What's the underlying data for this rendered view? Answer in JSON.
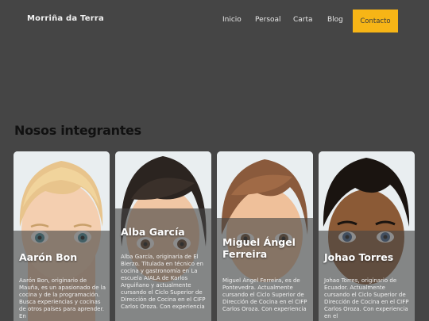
{
  "navbar": {
    "brand": "Morriña da Terra",
    "links": [
      "Inicio",
      "Persoal",
      "Carta",
      "Blog"
    ],
    "cta": "Contacto"
  },
  "colors": {
    "background": "#454545",
    "accent": "#f7b516"
  },
  "section": {
    "title": "Nosos integrantes"
  },
  "members": [
    {
      "name": "Aarón Bon",
      "text": "Aarón Bon, originario de Mauña, es un apasionado de la cocina y de la programación. Busca experiencias y cocinas de otros países para aprender. En"
    },
    {
      "name": "Alba García",
      "text": "Alba García, originaria de El Bierzo. Titulada en técnico en cocina y gastronomía en La escuela AIALA de Karlos Arguiñano y actualmente cursando el Ciclo Superior de Dirección de Cocina en el CIFP Carlos Oroza. Con experiencia"
    },
    {
      "name": "Miguel Ángel Ferreira",
      "text": "Miguel Ángel Ferreira, es de Pontevedra. Actualmente cursando el Ciclo Superior de Dirección de Cocina en el CIFP Carlos Oroza. Con experiencia"
    },
    {
      "name": "Johao Torres",
      "text": "Johao Torres, originario de Ecuador. Actualmente cursando el Ciclo Superior de Dirección de Cocina en el CIFP Carlos Oroza. Con experiencia en el"
    }
  ]
}
